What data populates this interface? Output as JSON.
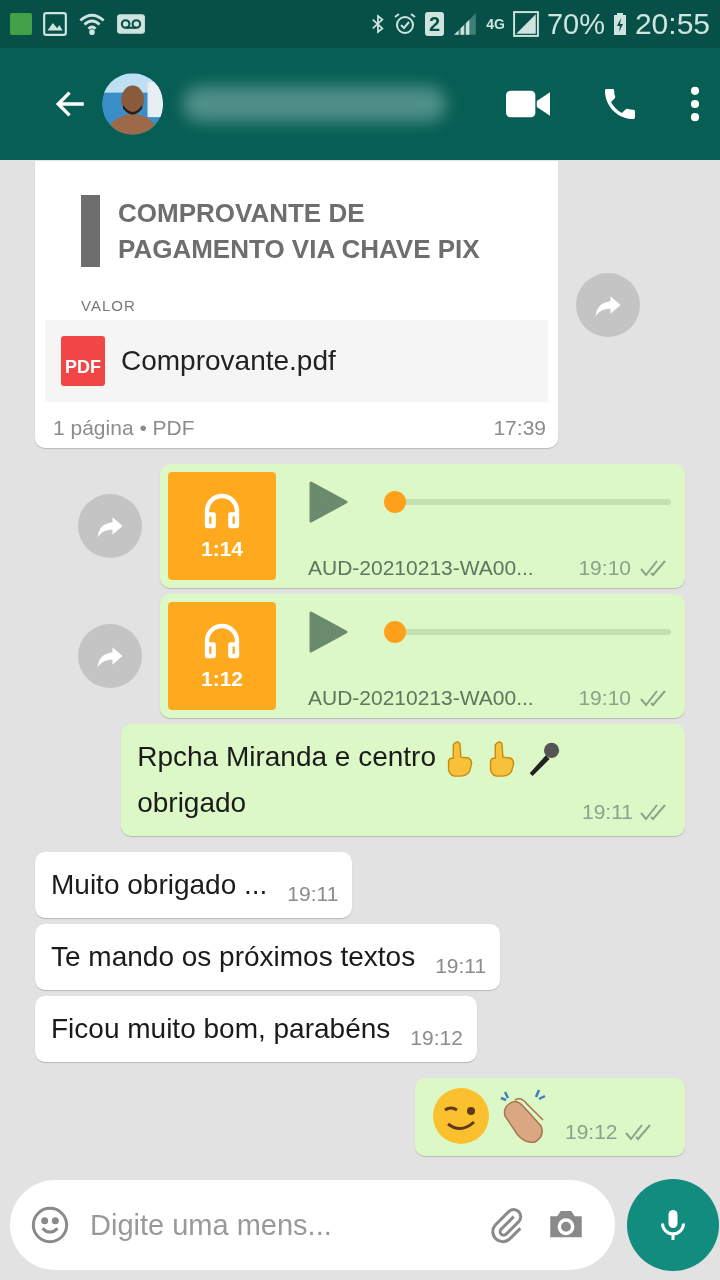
{
  "status_bar": {
    "sim": "2",
    "network": "4G",
    "battery": "70%",
    "time": "20:55"
  },
  "header": {
    "contact_name_blurred": true
  },
  "messages": [
    {
      "kind": "document",
      "outgoing": false,
      "forward": true,
      "preview_title": [
        "COMPROVANTE DE",
        "PAGAMENTO VIA CHAVE PIX"
      ],
      "preview_label": "VALOR",
      "file_name": "Comprovante.pdf",
      "file_icon": "PDF",
      "meta": "1 página • PDF",
      "time": "17:39"
    },
    {
      "kind": "audio",
      "outgoing": true,
      "forward": true,
      "duration": "1:14",
      "level": 0,
      "file_name": "AUD-20210213-WA00...",
      "time": "19:10",
      "read": false
    },
    {
      "kind": "audio",
      "outgoing": true,
      "forward": true,
      "duration": "1:12",
      "level": 0,
      "file_name": "AUD-20210213-WA00...",
      "time": "19:10",
      "read": false
    },
    {
      "kind": "text",
      "outgoing": true,
      "forward": false,
      "text": "Rpcha Miranda e centro",
      "emojis": [
        {
          "kind": "point-up"
        },
        {
          "kind": "point-up"
        },
        {
          "kind": "microphone"
        }
      ],
      "text_after": "obrigado",
      "time": "19:11",
      "read": false
    },
    {
      "kind": "text",
      "outgoing": false,
      "forward": false,
      "text": "Muito obrigado ...",
      "time": "19:11"
    },
    {
      "kind": "text",
      "outgoing": false,
      "forward": false,
      "text": "Te mando os próximos textos",
      "time": "19:11"
    },
    {
      "kind": "text",
      "outgoing": false,
      "forward": false,
      "text": "Ficou muito bom, parabéns",
      "time": "19:12"
    },
    {
      "kind": "emoji",
      "outgoing": true,
      "forward": false,
      "emojis": [
        {
          "kind": "wink"
        },
        {
          "kind": "clap"
        }
      ],
      "time": "19:12",
      "read": false
    }
  ],
  "composer": {
    "placeholder": "Digite uma mens..."
  }
}
